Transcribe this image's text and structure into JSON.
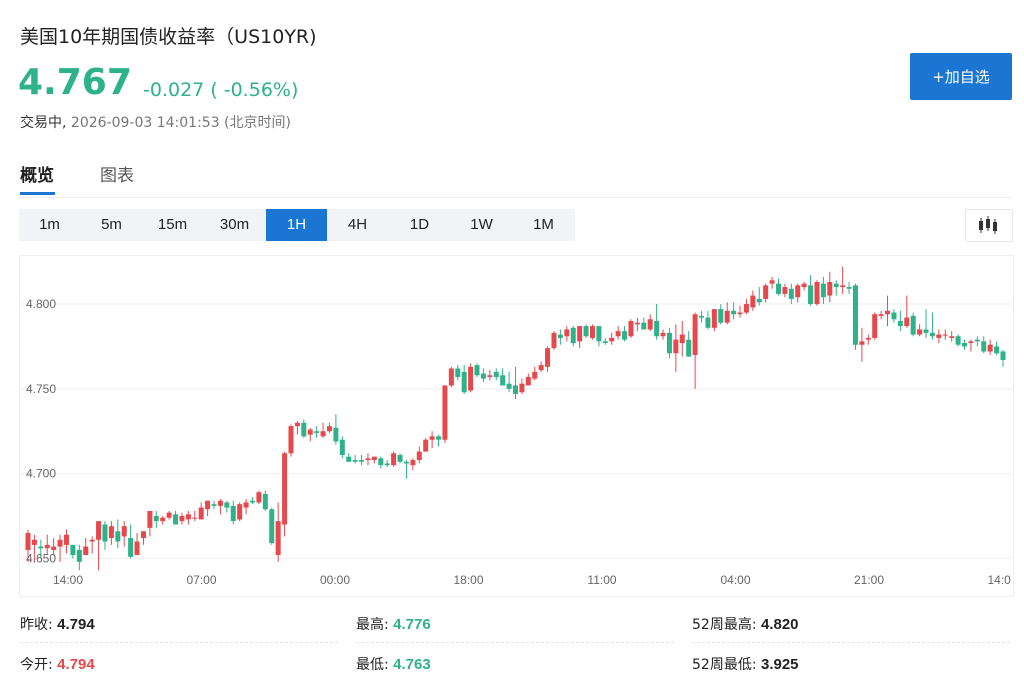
{
  "header": {
    "title": "美国10年期国债收益率（US10YR)",
    "price": "4.767",
    "change": "-0.027 ( -0.56%)",
    "status_label": "交易中,",
    "timestamp": "2026-09-03 14:01:53 (北京时间)",
    "add_button": "+加自选"
  },
  "tabs": [
    {
      "label": "概览",
      "active": true
    },
    {
      "label": "图表",
      "active": false
    }
  ],
  "intervals": [
    {
      "label": "1m",
      "active": false
    },
    {
      "label": "5m",
      "active": false
    },
    {
      "label": "15m",
      "active": false
    },
    {
      "label": "30m",
      "active": false
    },
    {
      "label": "1H",
      "active": true
    },
    {
      "label": "4H",
      "active": false
    },
    {
      "label": "1D",
      "active": false
    },
    {
      "label": "1W",
      "active": false
    },
    {
      "label": "1M",
      "active": false
    }
  ],
  "chart_type_icon": "candlestick-icon",
  "colors": {
    "accent": "#1a76d2",
    "up": "#e5484d",
    "down": "#2db28a"
  },
  "chart_data": {
    "type": "candlestick",
    "ylim": [
      4.642,
      4.822
    ],
    "yticks": [
      "4.650",
      "4.700",
      "4.750",
      "4.800"
    ],
    "xticks": [
      "14:00",
      "07:00",
      "00:00",
      "18:00",
      "11:00",
      "04:00",
      "21:00",
      "14:0"
    ],
    "grid": true,
    "up_color": "red",
    "down_color": "green",
    "candles": [
      [
        4.655,
        4.665,
        4.657,
        4.667,
        4.648
      ],
      [
        4.658,
        4.661,
        4.652,
        4.664,
        4.648
      ],
      [
        4.657,
        4.656,
        4.652,
        4.661,
        4.65
      ],
      [
        4.656,
        4.658,
        4.653,
        4.664,
        4.652
      ],
      [
        4.655,
        4.657,
        4.652,
        4.662,
        4.652
      ],
      [
        4.657,
        4.661,
        4.653,
        4.664,
        4.648
      ],
      [
        4.658,
        4.664,
        4.656,
        4.667,
        4.653
      ],
      [
        4.658,
        4.652,
        4.652,
        4.658,
        4.65
      ],
      [
        4.655,
        4.648,
        4.647,
        4.658,
        4.643
      ],
      [
        4.652,
        4.657,
        4.652,
        4.662,
        4.652
      ],
      [
        4.66,
        4.661,
        4.655,
        4.663,
        4.653
      ],
      [
        4.661,
        4.672,
        4.66,
        4.672,
        4.643
      ],
      [
        4.67,
        4.66,
        4.658,
        4.672,
        4.655
      ],
      [
        4.662,
        4.669,
        4.658,
        4.672,
        4.658
      ],
      [
        4.666,
        4.66,
        4.658,
        4.673,
        4.656
      ],
      [
        4.663,
        4.669,
        4.657,
        4.672,
        4.657
      ],
      [
        4.662,
        4.651,
        4.648,
        4.67,
        4.65
      ],
      [
        4.652,
        4.66,
        4.651,
        4.665,
        4.652
      ],
      [
        4.662,
        4.666,
        4.659,
        4.666,
        4.658
      ],
      [
        4.668,
        4.678,
        4.667,
        4.678,
        4.663
      ],
      [
        4.675,
        4.672,
        4.67,
        4.678,
        4.668
      ],
      [
        4.672,
        4.674,
        4.67,
        4.675,
        4.67
      ],
      [
        4.674,
        4.677,
        4.67,
        4.678,
        4.673
      ],
      [
        4.676,
        4.67,
        4.67,
        4.678,
        4.67
      ],
      [
        4.672,
        4.675,
        4.671,
        4.677,
        4.67
      ],
      [
        4.673,
        4.676,
        4.672,
        4.678,
        4.67
      ],
      [
        4.674,
        4.674,
        4.672,
        4.678,
        4.672
      ],
      [
        4.673,
        4.68,
        4.673,
        4.683,
        4.673
      ],
      [
        4.679,
        4.684,
        4.678,
        4.684,
        4.675
      ],
      [
        4.682,
        4.681,
        4.679,
        4.684,
        4.679
      ],
      [
        4.681,
        4.684,
        4.68,
        4.685,
        4.676
      ],
      [
        4.683,
        4.68,
        4.678,
        4.684,
        4.677
      ],
      [
        4.681,
        4.672,
        4.671,
        4.684,
        4.67
      ],
      [
        4.673,
        4.682,
        4.672,
        4.683,
        4.672
      ],
      [
        4.68,
        4.683,
        4.68,
        4.685,
        4.676
      ],
      [
        4.684,
        4.683,
        4.682,
        4.686,
        4.682
      ],
      [
        4.683,
        4.689,
        4.682,
        4.69,
        4.682
      ],
      [
        4.688,
        4.679,
        4.676,
        4.69,
        4.678
      ],
      [
        4.679,
        4.659,
        4.659,
        4.68,
        4.658
      ],
      [
        4.652,
        4.672,
        4.65,
        4.683,
        4.648
      ],
      [
        4.67,
        4.712,
        4.669,
        4.713,
        4.663
      ],
      [
        4.712,
        4.728,
        4.71,
        4.729,
        4.71
      ],
      [
        4.728,
        4.73,
        4.723,
        4.731,
        4.723
      ],
      [
        4.73,
        4.722,
        4.719,
        4.732,
        4.721
      ],
      [
        4.723,
        4.726,
        4.72,
        4.727,
        4.719
      ],
      [
        4.725,
        4.724,
        4.721,
        4.728,
        4.721
      ],
      [
        4.722,
        4.725,
        4.721,
        4.73,
        4.721
      ],
      [
        4.725,
        4.728,
        4.723,
        4.73,
        4.724
      ],
      [
        4.727,
        4.719,
        4.72,
        4.735,
        4.717
      ],
      [
        4.72,
        4.711,
        4.709,
        4.722,
        4.709
      ],
      [
        4.71,
        4.707,
        4.707,
        4.712,
        4.707
      ],
      [
        4.708,
        4.707,
        4.706,
        4.711,
        4.706
      ],
      [
        4.708,
        4.707,
        4.708,
        4.711,
        4.705
      ],
      [
        4.708,
        4.709,
        4.707,
        4.712,
        4.705
      ],
      [
        4.708,
        4.71,
        4.708,
        4.71,
        4.706
      ],
      [
        4.709,
        4.705,
        4.704,
        4.71,
        4.703
      ],
      [
        4.706,
        4.705,
        4.704,
        4.708,
        4.704
      ],
      [
        4.705,
        4.712,
        4.705,
        4.713,
        4.704
      ],
      [
        4.711,
        4.707,
        4.706,
        4.712,
        4.706
      ],
      [
        4.707,
        4.706,
        4.706,
        4.708,
        4.697
      ],
      [
        4.705,
        4.708,
        4.702,
        4.709,
        4.702
      ],
      [
        4.708,
        4.713,
        4.707,
        4.716,
        4.706
      ],
      [
        4.713,
        4.72,
        4.713,
        4.721,
        4.713
      ],
      [
        4.72,
        4.722,
        4.717,
        4.725,
        4.715
      ],
      [
        4.722,
        4.72,
        4.718,
        4.723,
        4.716
      ],
      [
        4.72,
        4.752,
        4.719,
        4.752,
        4.718
      ],
      [
        4.752,
        4.762,
        4.751,
        4.763,
        4.751
      ],
      [
        4.762,
        4.757,
        4.755,
        4.764,
        4.755
      ],
      [
        4.76,
        4.748,
        4.747,
        4.764,
        4.747
      ],
      [
        4.749,
        4.763,
        4.748,
        4.765,
        4.748
      ],
      [
        4.764,
        4.758,
        4.757,
        4.765,
        4.757
      ],
      [
        4.759,
        4.756,
        4.757,
        4.762,
        4.754
      ],
      [
        4.757,
        4.758,
        4.755,
        4.761,
        4.755
      ],
      [
        4.76,
        4.757,
        4.755,
        4.762,
        4.755
      ],
      [
        4.758,
        4.752,
        4.752,
        4.762,
        4.752
      ],
      [
        4.753,
        4.75,
        4.748,
        4.76,
        4.748
      ],
      [
        4.752,
        4.747,
        4.743,
        4.763,
        4.744
      ],
      [
        4.748,
        4.753,
        4.747,
        4.756,
        4.747
      ],
      [
        4.752,
        4.757,
        4.752,
        4.759,
        4.752
      ],
      [
        4.756,
        4.76,
        4.755,
        4.763,
        4.755
      ],
      [
        4.761,
        4.764,
        4.76,
        4.766,
        4.76
      ],
      [
        4.763,
        4.774,
        4.761,
        4.775,
        4.76
      ],
      [
        4.774,
        4.783,
        4.773,
        4.784,
        4.773
      ],
      [
        4.782,
        4.78,
        4.776,
        4.785,
        4.776
      ],
      [
        4.781,
        4.785,
        4.778,
        4.787,
        4.778
      ],
      [
        4.786,
        4.777,
        4.776,
        4.787,
        4.775
      ],
      [
        4.778,
        4.787,
        4.776,
        4.787,
        4.774
      ],
      [
        4.787,
        4.781,
        4.78,
        4.788,
        4.78
      ],
      [
        4.78,
        4.787,
        4.779,
        4.788,
        4.779
      ],
      [
        4.787,
        4.778,
        4.775,
        4.787,
        4.775
      ],
      [
        4.778,
        4.777,
        4.776,
        4.78,
        4.776
      ],
      [
        4.778,
        4.78,
        4.777,
        4.783,
        4.776
      ],
      [
        4.781,
        4.784,
        4.78,
        4.787,
        4.779
      ],
      [
        4.784,
        4.779,
        4.778,
        4.787,
        4.778
      ],
      [
        4.781,
        4.79,
        4.78,
        4.791,
        4.78
      ],
      [
        4.788,
        4.789,
        4.784,
        4.792,
        4.784
      ],
      [
        4.789,
        4.785,
        4.784,
        4.792,
        4.785
      ],
      [
        4.785,
        4.791,
        4.785,
        4.794,
        4.784
      ],
      [
        4.79,
        4.781,
        4.779,
        4.8,
        4.779
      ],
      [
        4.781,
        4.783,
        4.779,
        4.785,
        4.779
      ],
      [
        4.783,
        4.771,
        4.768,
        4.786,
        4.768
      ],
      [
        4.771,
        4.779,
        4.77,
        4.788,
        4.76
      ],
      [
        4.777,
        4.782,
        4.778,
        4.79,
        4.769
      ],
      [
        4.779,
        4.769,
        4.769,
        4.784,
        4.769
      ],
      [
        4.77,
        4.794,
        4.769,
        4.795,
        4.75
      ],
      [
        4.793,
        4.792,
        4.789,
        4.796,
        4.789
      ],
      [
        4.792,
        4.786,
        4.785,
        4.796,
        4.785
      ],
      [
        4.786,
        4.797,
        4.784,
        4.797,
        4.784
      ],
      [
        4.797,
        4.789,
        4.788,
        4.8,
        4.788
      ],
      [
        4.789,
        4.796,
        4.789,
        4.801,
        4.788
      ],
      [
        4.796,
        4.794,
        4.791,
        4.801,
        4.791
      ],
      [
        4.794,
        4.795,
        4.792,
        4.799,
        4.792
      ],
      [
        4.795,
        4.8,
        4.794,
        4.803,
        4.794
      ],
      [
        4.798,
        4.805,
        4.796,
        4.808,
        4.796
      ],
      [
        4.803,
        4.801,
        4.799,
        4.81,
        4.799
      ],
      [
        4.803,
        4.811,
        4.802,
        4.812,
        4.801
      ],
      [
        4.812,
        4.814,
        4.809,
        4.816,
        4.809
      ],
      [
        4.812,
        4.806,
        4.805,
        4.815,
        4.805
      ],
      [
        4.806,
        4.81,
        4.805,
        4.812,
        4.804
      ],
      [
        4.809,
        4.803,
        4.8,
        4.812,
        4.8
      ],
      [
        4.804,
        4.811,
        4.803,
        4.812,
        4.801
      ],
      [
        4.81,
        4.812,
        4.808,
        4.813,
        4.808
      ],
      [
        4.811,
        4.8,
        4.799,
        4.817,
        4.799
      ],
      [
        4.8,
        4.813,
        4.8,
        4.814,
        4.799
      ],
      [
        4.812,
        4.804,
        4.804,
        4.816,
        4.8
      ],
      [
        4.805,
        4.813,
        4.801,
        4.819,
        4.801
      ],
      [
        4.812,
        4.81,
        4.808,
        4.814,
        4.805
      ],
      [
        4.81,
        4.811,
        4.808,
        4.822,
        4.806
      ],
      [
        4.81,
        4.809,
        4.808,
        4.813,
        4.806
      ],
      [
        4.811,
        4.776,
        4.774,
        4.812,
        4.773
      ],
      [
        4.776,
        4.778,
        4.768,
        4.786,
        4.766
      ],
      [
        4.779,
        4.78,
        4.777,
        4.782,
        4.776
      ],
      [
        4.78,
        4.794,
        4.779,
        4.795,
        4.779
      ],
      [
        4.793,
        4.794,
        4.791,
        4.796,
        4.791
      ],
      [
        4.794,
        4.796,
        4.787,
        4.805,
        4.787
      ],
      [
        4.795,
        4.791,
        4.789,
        4.797,
        4.789
      ],
      [
        4.79,
        4.787,
        4.785,
        4.796,
        4.784
      ],
      [
        4.787,
        4.792,
        4.787,
        4.805,
        4.786
      ],
      [
        4.793,
        4.782,
        4.781,
        4.795,
        4.781
      ],
      [
        4.782,
        4.785,
        4.782,
        4.788,
        4.781
      ],
      [
        4.785,
        4.783,
        4.78,
        4.797,
        4.78
      ],
      [
        4.783,
        4.781,
        4.779,
        4.795,
        4.779
      ],
      [
        4.78,
        4.782,
        4.78,
        4.785,
        4.777
      ],
      [
        4.782,
        4.782,
        4.78,
        4.785,
        4.779
      ],
      [
        4.78,
        4.781,
        4.778,
        4.784,
        4.778
      ],
      [
        4.781,
        4.776,
        4.775,
        4.782,
        4.775
      ],
      [
        4.777,
        4.775,
        4.773,
        4.779,
        4.773
      ],
      [
        4.777,
        4.778,
        4.775,
        4.779,
        4.772
      ],
      [
        4.779,
        4.778,
        4.775,
        4.781,
        4.775
      ],
      [
        4.778,
        4.772,
        4.771,
        4.781,
        4.771
      ],
      [
        4.772,
        4.776,
        4.772,
        4.779,
        4.77
      ],
      [
        4.775,
        4.771,
        4.771,
        4.778,
        4.77
      ],
      [
        4.772,
        4.767,
        4.766,
        4.773,
        4.763
      ]
    ]
  },
  "stats": [
    {
      "label": "昨收:",
      "value": "4.794",
      "tone": "neutral"
    },
    {
      "label": "最高:",
      "value": "4.776",
      "tone": "down"
    },
    {
      "label": "52周最高:",
      "value": "4.820",
      "tone": "neutral"
    },
    {
      "label": "今开:",
      "value": "4.794",
      "tone": "up"
    },
    {
      "label": "最低:",
      "value": "4.763",
      "tone": "down"
    },
    {
      "label": "52周最低:",
      "value": "3.925",
      "tone": "neutral"
    }
  ]
}
